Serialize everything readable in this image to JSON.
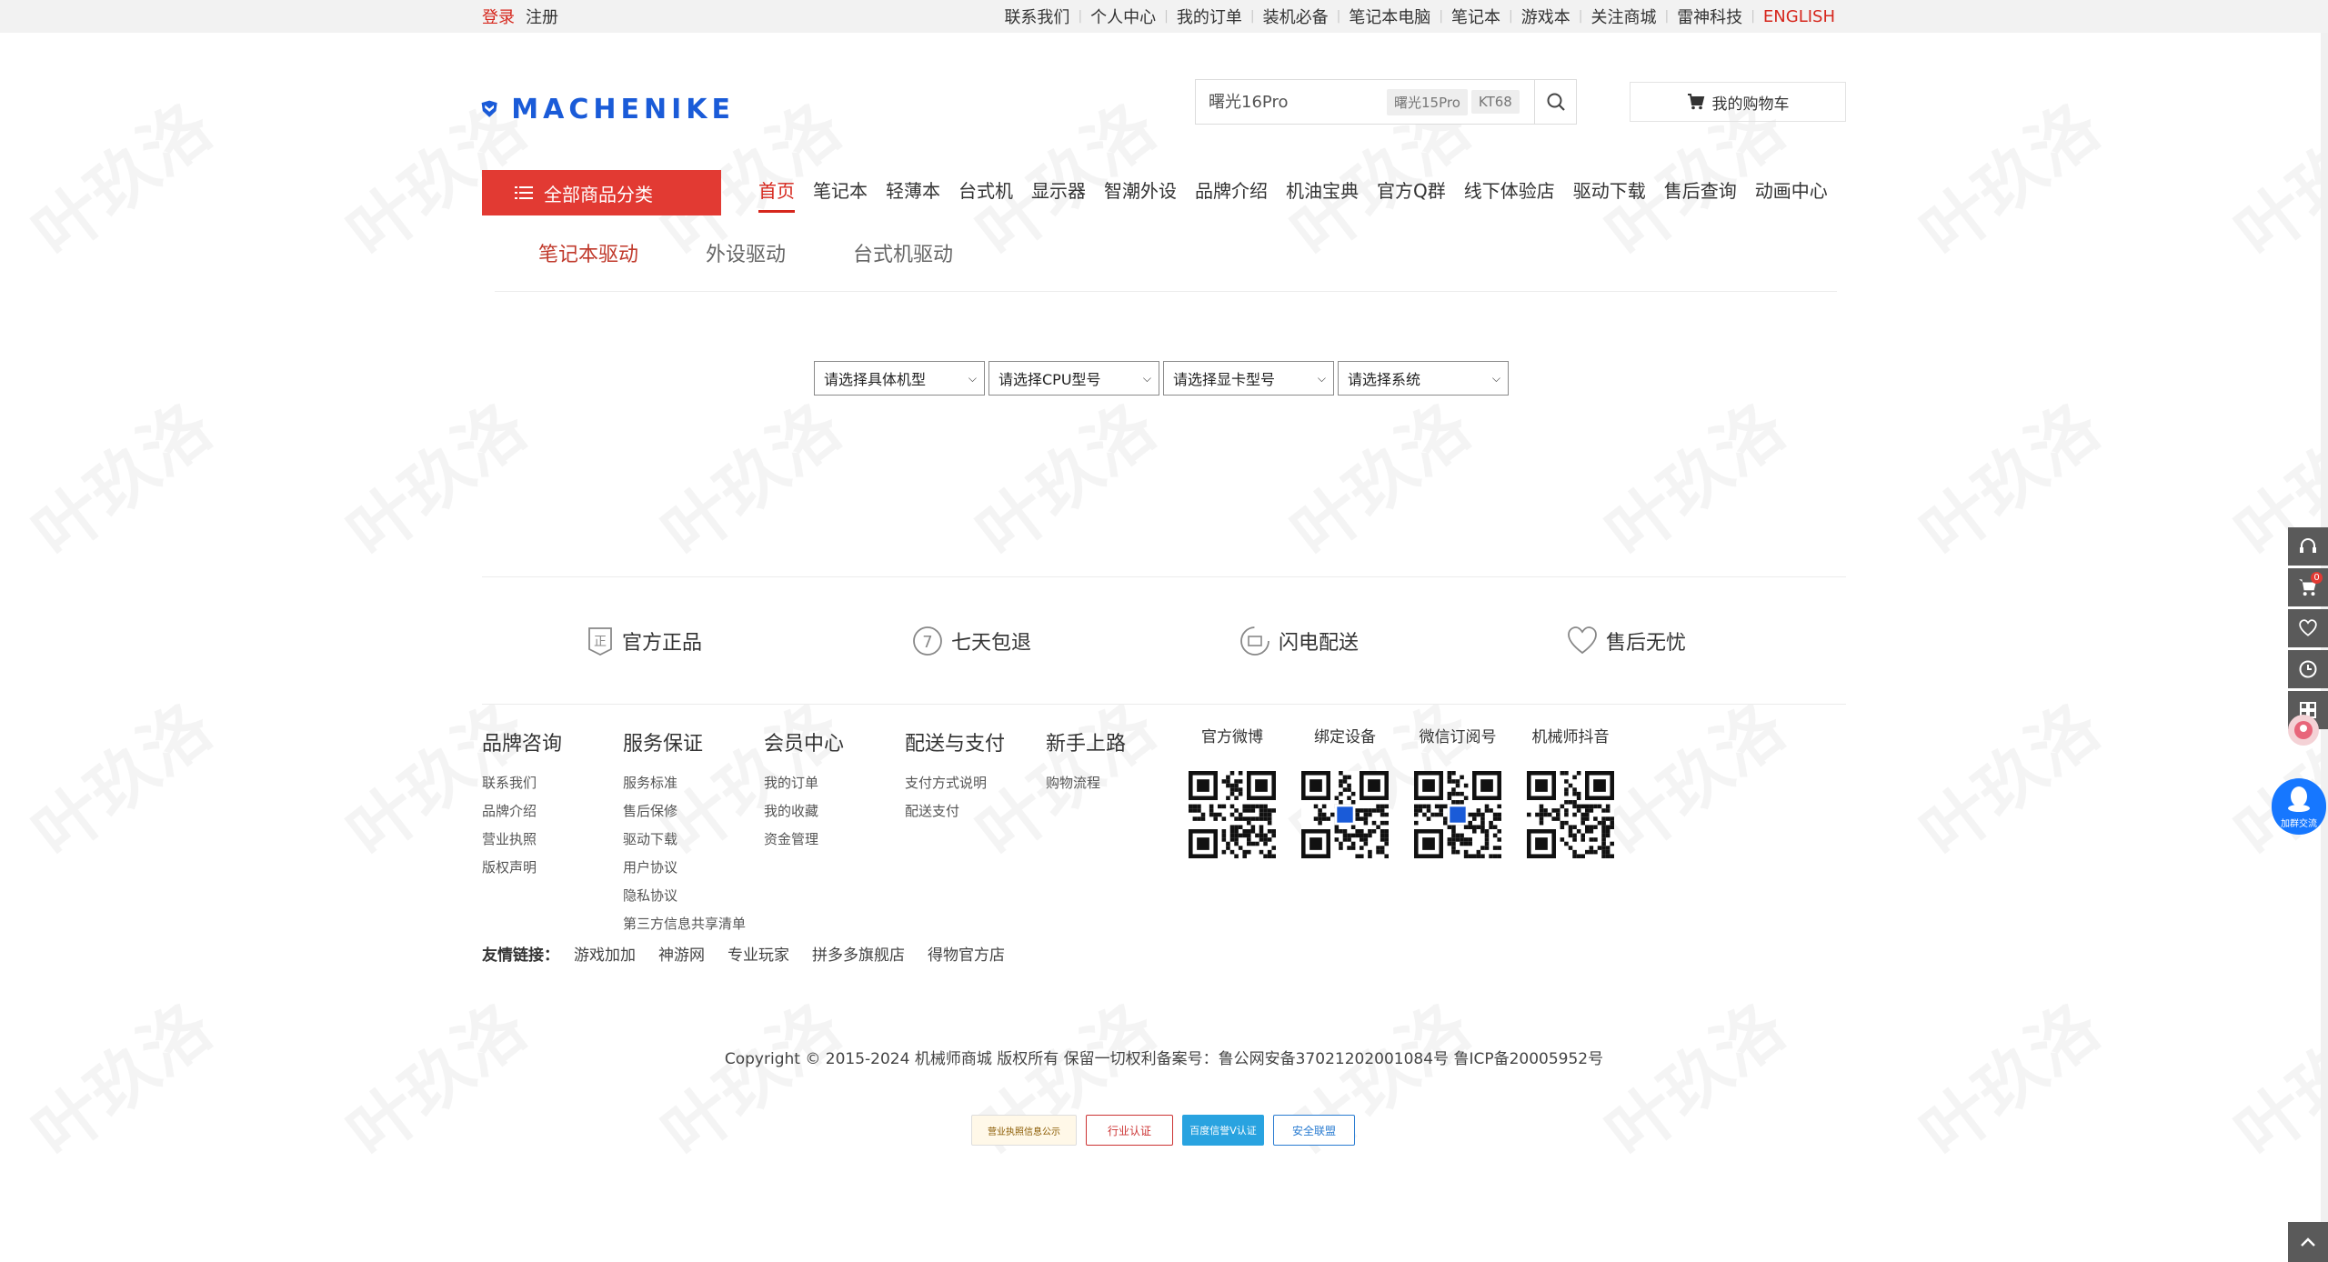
{
  "watermark_text": "叶玖洛",
  "topbar": {
    "login": "登录",
    "register": "注册",
    "links": [
      "联系我们",
      "个人中心",
      "我的订单",
      "装机必备",
      "笔记本电脑",
      "笔记本",
      "游戏本",
      "关注商城",
      "雷神科技",
      "ENGLISH"
    ]
  },
  "header": {
    "logo_text": "MACHENIKE",
    "search_placeholder": "曙光16Pro",
    "hot_tags": [
      "曙光15Pro",
      "KT68"
    ],
    "cart_label": "我的购物车"
  },
  "nav": {
    "all_categories": "全部商品分类",
    "items": [
      "首页",
      "笔记本",
      "轻薄本",
      "台式机",
      "显示器",
      "智潮外设",
      "品牌介绍",
      "机油宝典",
      "官方Q群",
      "线下体验店",
      "驱动下载",
      "售后查询",
      "动画中心"
    ]
  },
  "subtabs": [
    "笔记本驱动",
    "外设驱动",
    "台式机驱动"
  ],
  "filters": [
    "请选择具体机型",
    "请选择CPU型号",
    "请选择显卡型号",
    "请选择系统"
  ],
  "guarantees": [
    "官方正品",
    "七天包退",
    "闪电配送",
    "售后无忧"
  ],
  "footer": {
    "columns": [
      {
        "title": "品牌咨询",
        "links": [
          "联系我们",
          "品牌介绍",
          "营业执照",
          "版权声明"
        ]
      },
      {
        "title": "服务保证",
        "links": [
          "服务标准",
          "售后保修",
          "驱动下载",
          "用户协议",
          "隐私协议",
          "第三方信息共享清单"
        ]
      },
      {
        "title": "会员中心",
        "links": [
          "我的订单",
          "我的收藏",
          "资金管理"
        ]
      },
      {
        "title": "配送与支付",
        "links": [
          "支付方式说明",
          "配送支付"
        ]
      },
      {
        "title": "新手上路",
        "links": [
          "购物流程"
        ]
      }
    ],
    "qr_codes": [
      "官方微博",
      "绑定设备",
      "微信订阅号",
      "机械师抖音"
    ],
    "friend_label": "友情链接：",
    "friend_links": [
      "游戏加加",
      "神游网",
      "专业玩家",
      "拼多多旗舰店",
      "得物官方店"
    ],
    "copyright": "Copyright © 2015-2024 机械师商城 版权所有 保留一切权利备案号：鲁公网安备37021202001084号 鲁ICP备20005952号",
    "badges": [
      "营业执照信息公示",
      "行业认证",
      "百度信誉V认证",
      "安全联盟"
    ]
  },
  "side_tools": {
    "cart_count": "0",
    "qq_group_label": "加群交流"
  },
  "colors": {
    "brand_red": "#e23a33",
    "brand_blue": "#1a5bd8",
    "link_red": "#d6261c"
  }
}
